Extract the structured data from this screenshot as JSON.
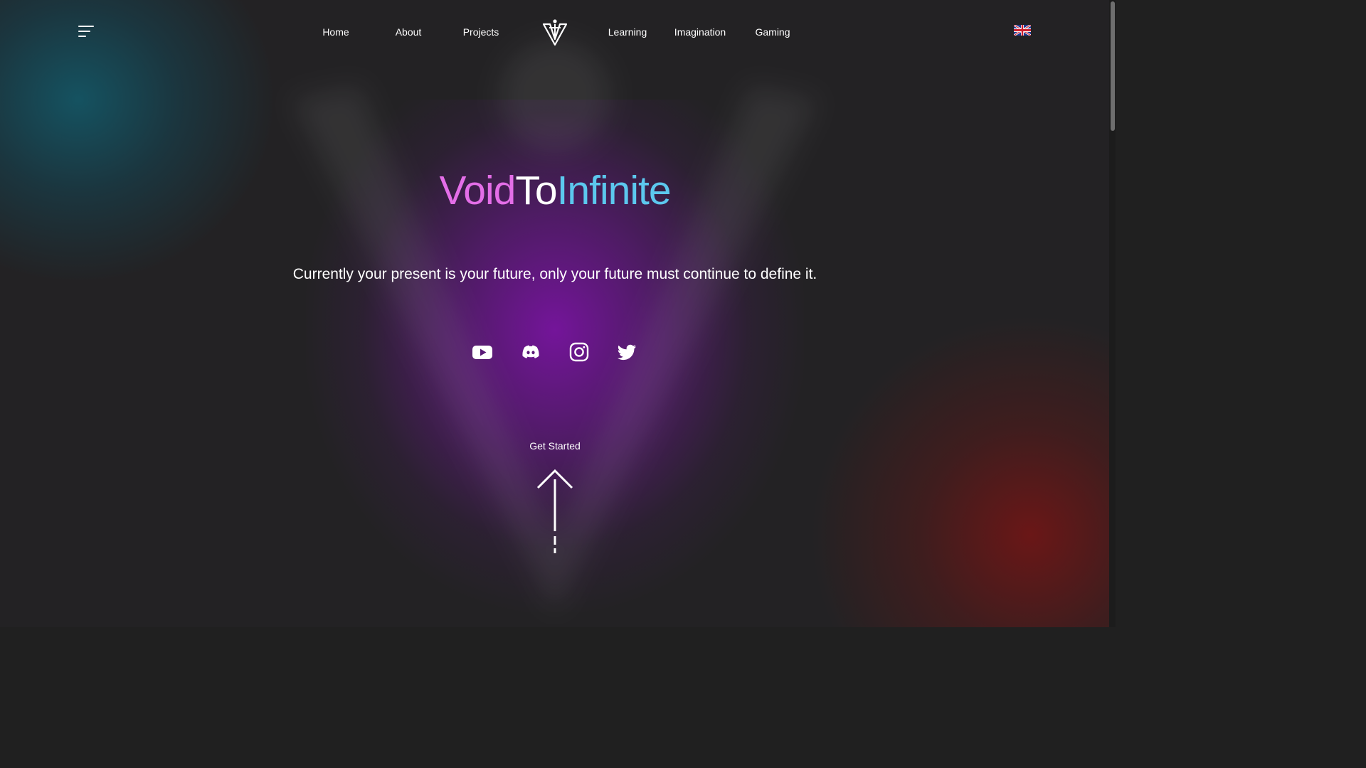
{
  "header": {
    "nav_left": [
      "Home",
      "About",
      "Projects"
    ],
    "nav_right": [
      "Learning",
      "Imagination",
      "Gaming"
    ],
    "language_icon": "uk-flag-icon",
    "menu_icon": "hamburger-menu-icon",
    "logo_icon": "v-logo-icon"
  },
  "hero": {
    "title_part1": "Void",
    "title_part2": "To",
    "title_part3": "Infinite",
    "tagline": "Currently your present is your future, only your future must continue to define it.",
    "cta_label": "Get Started"
  },
  "social": [
    "youtube-icon",
    "discord-icon",
    "instagram-icon",
    "twitter-icon"
  ],
  "colors": {
    "title_pink": "#e46ee8",
    "title_white": "#ffffff",
    "title_cyan": "#5cc8ee",
    "glow_purple": "#7814a0",
    "glow_teal": "#145564",
    "glow_red": "#6e1616",
    "background": "#232224"
  }
}
